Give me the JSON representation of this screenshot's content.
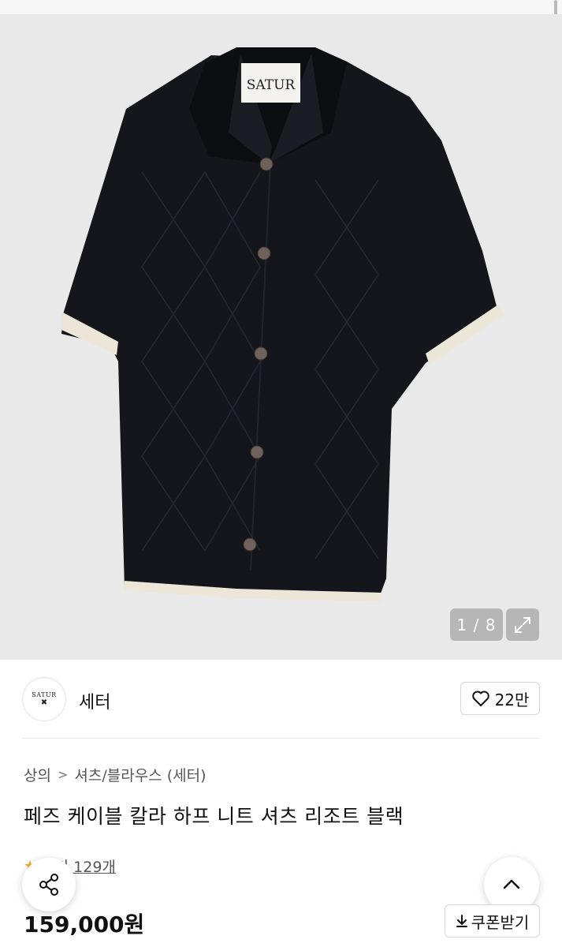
{
  "gallery": {
    "label_brand_tag": "SATUR",
    "counter": "1 / 8",
    "expand_icon": "expand-icon"
  },
  "brand": {
    "logo_text": "SATUR",
    "name": "세터",
    "like_count": "22만",
    "like_icon": "heart-icon"
  },
  "breadcrumb": {
    "level1": "상의",
    "separator": ">",
    "level2": "셔츠/블라우스 (세터)"
  },
  "product": {
    "title": "페즈 케이블 칼라 하프 니트 셔츠 리조트 블랙",
    "review_text": "후기 129개",
    "price": "159,000원"
  },
  "actions": {
    "coupon_label": "쿠폰받기",
    "share_icon": "share-icon",
    "scroll_top_icon": "chevron-up-icon"
  },
  "colors": {
    "hero_bg": "#e9e9e9",
    "shirt": "#14161c",
    "trim": "#ece6d8",
    "star": "#f5a623"
  }
}
